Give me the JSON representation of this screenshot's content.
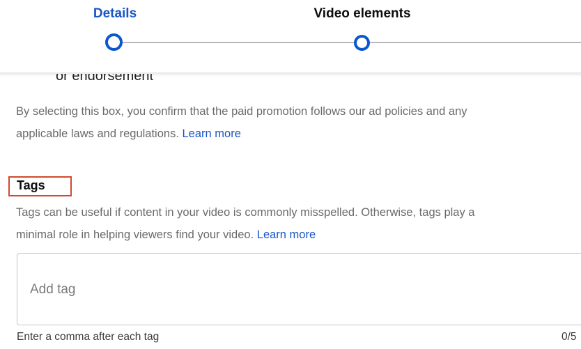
{
  "stepper": {
    "steps": [
      {
        "label": "Details",
        "state": "active"
      },
      {
        "label": "Video elements",
        "state": "upcoming"
      }
    ],
    "accent_color": "#0b57d0"
  },
  "paid_promotion": {
    "clipped_heading": "or endorsement",
    "description": "By selecting this box, you confirm that the paid promotion follows our ad policies and any",
    "description_line2": "applicable laws and regulations.",
    "learn_more": "Learn more"
  },
  "tags": {
    "title": "Tags",
    "description": "Tags can be useful if content in your video is commonly misspelled. Otherwise, tags play a",
    "description_line2": "minimal role in helping viewers find your video.",
    "learn_more": "Learn more",
    "input_value": "",
    "input_placeholder": "Add tag",
    "hint": "Enter a comma after each tag",
    "counter": "0/5"
  },
  "highlight_color": "#d04a2c"
}
